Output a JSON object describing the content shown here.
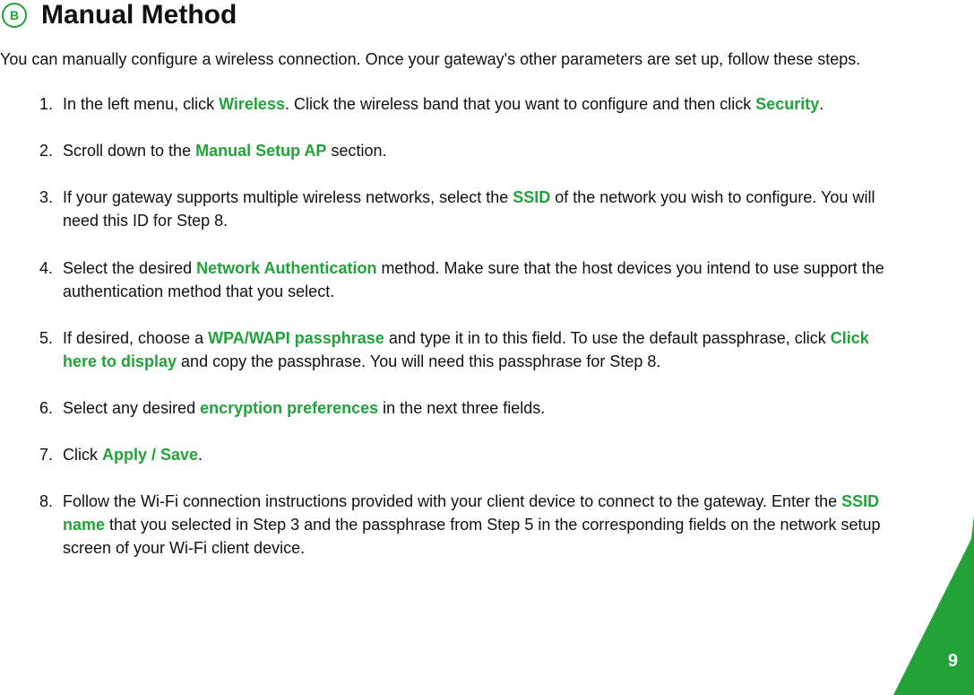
{
  "badge": {
    "letter": "B"
  },
  "title": "Manual Method",
  "intro": "You can manually configure a wireless connection. Once your gateway's other parameters are set up, follow these steps.",
  "steps": {
    "s1": {
      "a": "In the left menu, click ",
      "hl1": "Wireless",
      "b": ". Click the wireless band that you want to configure and then click ",
      "hl2": "Security",
      "c": "."
    },
    "s2": {
      "a": "Scroll down to the ",
      "hl1": "Manual Setup AP",
      "b": " section."
    },
    "s3": {
      "a": "If your gateway supports multiple wireless networks, select the ",
      "hl1": "SSID",
      "b": " of the network you wish to configure. You will need this ID for Step 8."
    },
    "s4": {
      "a": "Select the desired ",
      "hl1": "Network Authentication",
      "b": " method. Make sure that the host devices you intend to use support the authentication method that you select."
    },
    "s5": {
      "a": "If desired, choose a ",
      "hl1": "WPA/WAPI passphrase",
      "b": " and type it in to this field. To use the default passphrase, click ",
      "hl2": "Click here to display",
      "c": " and copy the passphrase. You will need this passphrase for Step 8."
    },
    "s6": {
      "a": "Select any desired ",
      "hl1": "encryption preferences",
      "b": " in the next three fields."
    },
    "s7": {
      "a": "Click ",
      "hl1": "Apply / Save",
      "b": "."
    },
    "s8": {
      "a": "Follow the Wi-Fi connection instructions provided with your client device to connect to the gateway. Enter the ",
      "hl1": "SSID name",
      "b": " that you selected in Step 3 and the passphrase from Step 5 in the corresponding fields on the network setup screen of your Wi-Fi client device."
    }
  },
  "pageNumber": "9"
}
